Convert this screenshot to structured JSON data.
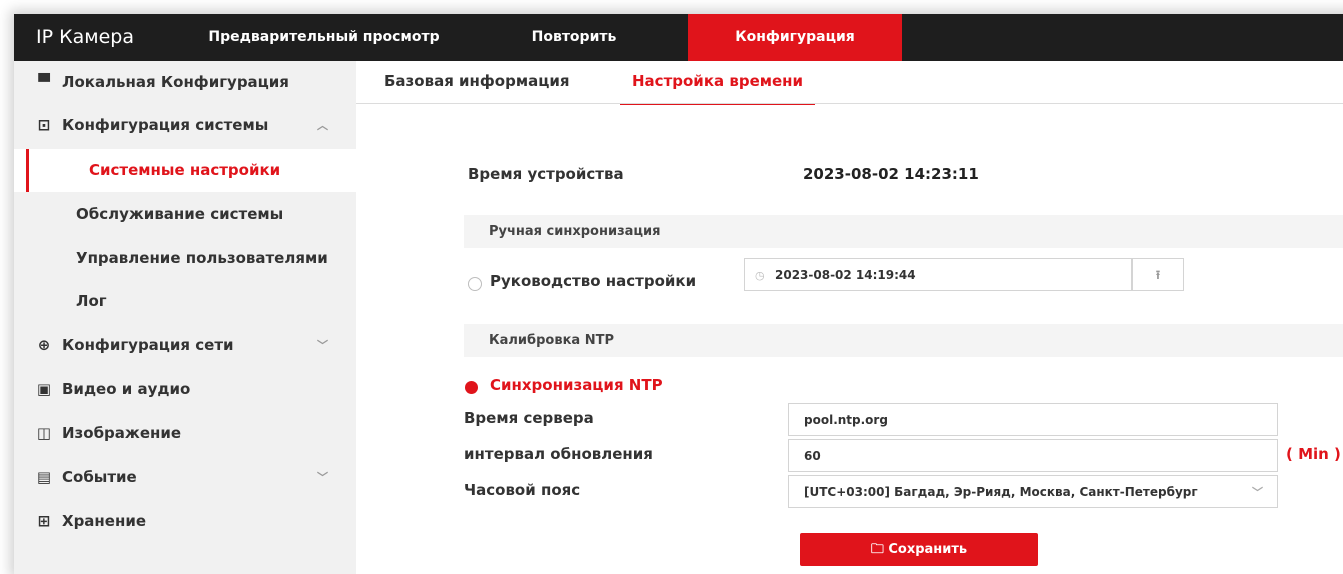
{
  "app": {
    "title": "IP Камера"
  },
  "top_nav": {
    "tabs": [
      {
        "label": "Предварительный просмотр"
      },
      {
        "label": "Повторить"
      },
      {
        "label": "Конфигурация"
      }
    ],
    "active_index": 2
  },
  "sidebar": {
    "items": [
      {
        "label": "Локальная Конфигурация",
        "icon": "monitor-icon"
      },
      {
        "label": "Конфигурация системы",
        "icon": "system-config-icon"
      },
      {
        "label": "Системные настройки"
      },
      {
        "label": "Обслуживание системы"
      },
      {
        "label": "Управление пользователями"
      },
      {
        "label": "Лог"
      },
      {
        "label": "Конфигурация сети",
        "icon": "globe-icon"
      },
      {
        "label": "Видео и аудио",
        "icon": "video-audio-icon"
      },
      {
        "label": "Изображение",
        "icon": "image-icon"
      },
      {
        "label": "Событие",
        "icon": "event-icon"
      },
      {
        "label": "Хранение",
        "icon": "storage-icon"
      }
    ],
    "active_item": "Системные настройки"
  },
  "subtabs": {
    "items": [
      {
        "label": "Базовая информация"
      },
      {
        "label": "Настройка времени"
      }
    ],
    "active_index": 1
  },
  "time_settings": {
    "device_time_label": "Время устройства",
    "device_time_value": "2023-08-02 14:23:11",
    "manual_section_title": "Ручная синхронизация",
    "manual_label": "Руководство настройки",
    "manual_value": "2023-08-02 14:19:44",
    "ntp_section_title": "Калибровка NTP",
    "ntp_sync_label": "Синхронизация NTP",
    "server_time_label": "Время сервера",
    "server_value": "pool.ntp.org",
    "interval_label": "интервал обновления",
    "interval_value": "60",
    "interval_unit": "( Min )",
    "timezone_label": "Часовой пояс",
    "timezone_value": "[UTC+03:00] Багдад, Эр-Рияд, Москва, Санкт-Петербург",
    "save_label": "Сохранить"
  },
  "colors": {
    "accent": "#e0141b",
    "topbar": "#1e1e1e",
    "sidebar_bg": "#f1f1f1"
  }
}
